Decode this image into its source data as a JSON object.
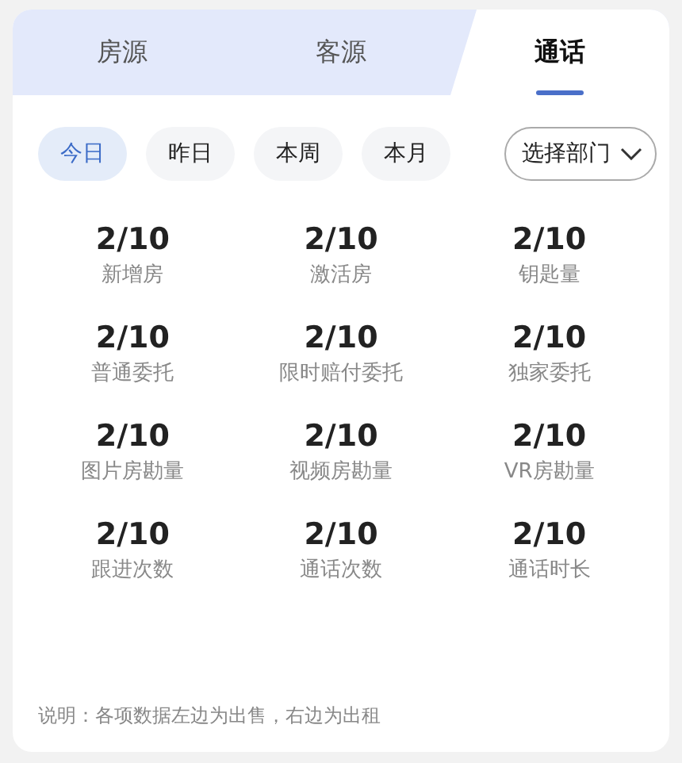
{
  "tabs": [
    {
      "label": "房源",
      "selected": false
    },
    {
      "label": "客源",
      "selected": false
    },
    {
      "label": "通话",
      "selected": true
    }
  ],
  "filters": [
    {
      "label": "今日",
      "selected": true
    },
    {
      "label": "昨日",
      "selected": false
    },
    {
      "label": "本周",
      "selected": false
    },
    {
      "label": "本月",
      "selected": false
    }
  ],
  "department_select": {
    "label": "选择部门"
  },
  "stats": [
    {
      "value": "2/10",
      "label": "新增房"
    },
    {
      "value": "2/10",
      "label": "激活房"
    },
    {
      "value": "2/10",
      "label": "钥匙量"
    },
    {
      "value": "2/10",
      "label": "普通委托"
    },
    {
      "value": "2/10",
      "label": "限时赔付委托"
    },
    {
      "value": "2/10",
      "label": "独家委托"
    },
    {
      "value": "2/10",
      "label": "图片房勘量"
    },
    {
      "value": "2/10",
      "label": "视频房勘量"
    },
    {
      "value": "2/10",
      "label": "VR房勘量"
    },
    {
      "value": "2/10",
      "label": "跟进次数"
    },
    {
      "value": "2/10",
      "label": "通话次数"
    },
    {
      "value": "2/10",
      "label": "通话时长"
    }
  ],
  "note": "说明：各项数据左边为出售，右边为出租"
}
